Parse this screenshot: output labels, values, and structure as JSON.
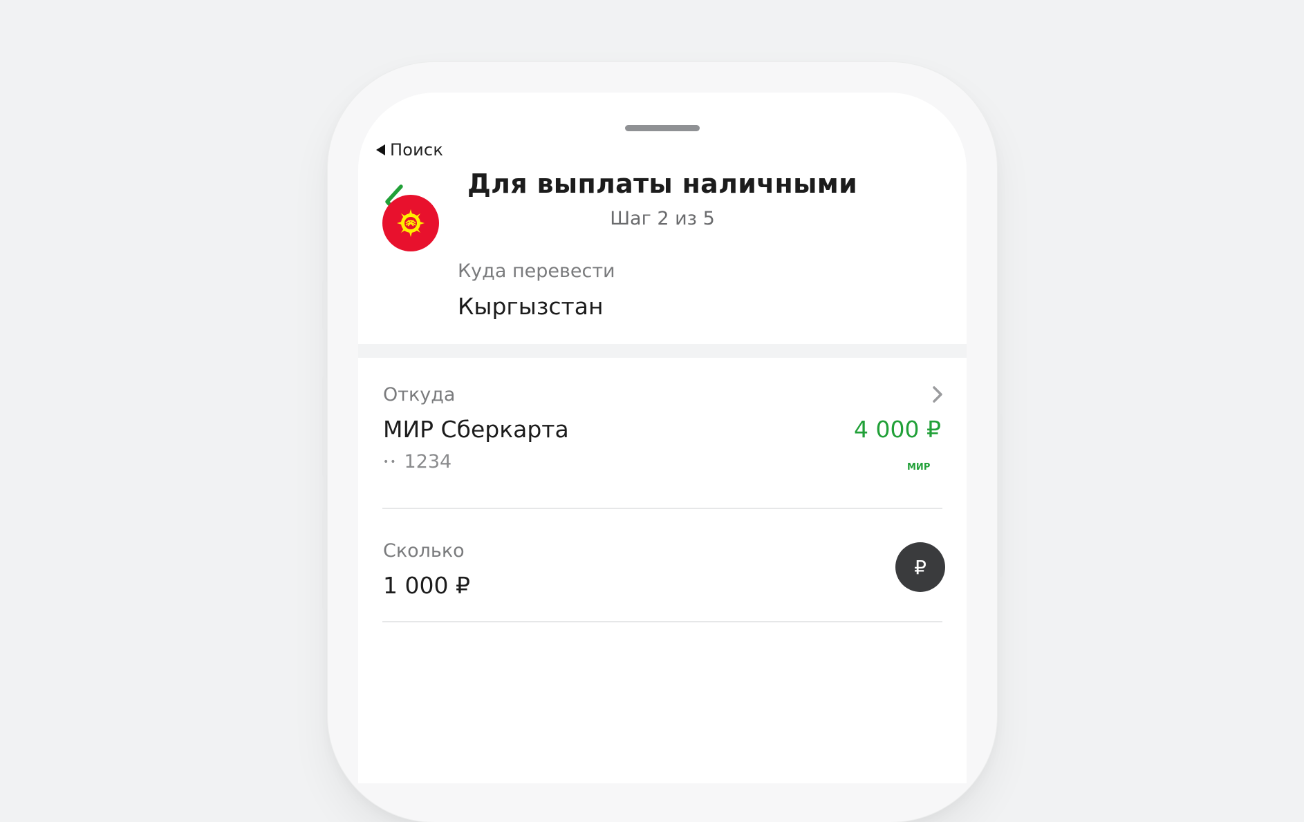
{
  "status_bar": {
    "back_app_label": "Поиск"
  },
  "header": {
    "title": "Для выплаты наличными",
    "step_text": "Шаг 2 из 5",
    "back_icon": "chevron-left-icon"
  },
  "destination": {
    "label": "Куда перевести",
    "value": "Кыргызстан",
    "flag_icon": "kyrgyzstan-flag-icon"
  },
  "from": {
    "label": "Откуда",
    "card_name": "МИР Сберкарта",
    "card_mask": "••",
    "card_last4": "1234",
    "balance": "4 000 ₽",
    "payment_system_logo": "МИР",
    "chevron_icon": "chevron-right-icon"
  },
  "amount": {
    "label": "Сколько",
    "value": "1 000 ₽",
    "currency_symbol": "₽"
  },
  "colors": {
    "accent_green": "#21a038",
    "flag_red": "#e8112d",
    "flag_yellow": "#ffef00",
    "currency_button_bg": "#3a3b3d"
  }
}
